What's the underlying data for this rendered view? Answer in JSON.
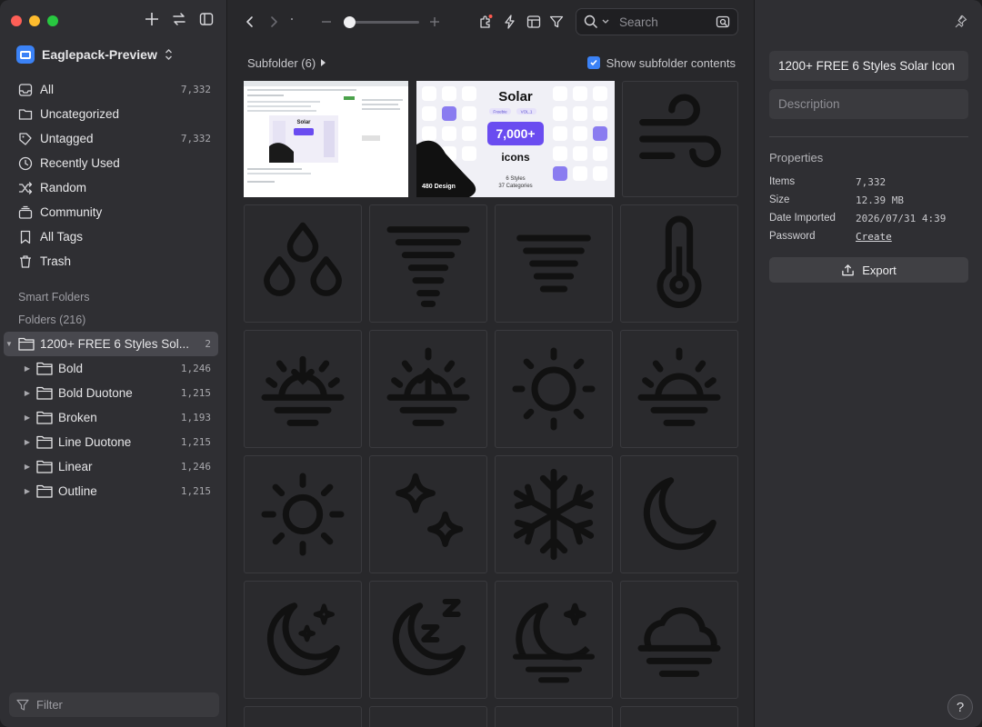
{
  "library": {
    "name": "Eaglepack-Preview"
  },
  "nav": [
    {
      "label": "All",
      "count": "7,332",
      "icon": "inbox-icon"
    },
    {
      "label": "Uncategorized",
      "count": "",
      "icon": "folder-question-icon"
    },
    {
      "label": "Untagged",
      "count": "7,332",
      "icon": "tag-off-icon"
    },
    {
      "label": "Recently Used",
      "count": "",
      "icon": "clock-icon"
    },
    {
      "label": "Random",
      "count": "",
      "icon": "shuffle-icon"
    },
    {
      "label": "Community",
      "count": "",
      "icon": "community-icon"
    },
    {
      "label": "All Tags",
      "count": "",
      "icon": "bookmark-icon"
    },
    {
      "label": "Trash",
      "count": "",
      "icon": "trash-icon"
    }
  ],
  "sections": {
    "smart_folders": "Smart Folders",
    "folders": "Folders (216)"
  },
  "folders": {
    "parent": {
      "label": "1200+ FREE 6 Styles Sol...",
      "count": "2"
    },
    "children": [
      {
        "label": "Bold",
        "count": "1,246"
      },
      {
        "label": "Bold Duotone",
        "count": "1,215"
      },
      {
        "label": "Broken",
        "count": "1,193"
      },
      {
        "label": "Line Duotone",
        "count": "1,215"
      },
      {
        "label": "Linear",
        "count": "1,246"
      },
      {
        "label": "Outline",
        "count": "1,215"
      }
    ]
  },
  "filter": {
    "placeholder": "Filter"
  },
  "toolbar": {
    "search_placeholder": "Search",
    "zoom_level": 0.07
  },
  "subfolder": {
    "title": "Subfolder (6)",
    "show_contents_label": "Show subfolder contents",
    "show_contents_checked": true
  },
  "previews": {
    "solar": {
      "title": "Solar",
      "count_badge": "7,000+",
      "word": "icons",
      "styles": "6 Styles",
      "categories": "37 Categories",
      "brand": "480 Design",
      "tag_a": "Freebie",
      "tag_b": "VOL.1"
    }
  },
  "icons": [
    "wind-icon",
    "raindrops-icon",
    "tornado-icon",
    "tornado-small-icon",
    "thermometer-icon",
    "sunset-icon",
    "sunrise-icon",
    "sun-icon",
    "sun-fog-icon",
    "sun-rays-icon",
    "stars-icon",
    "snowflake-icon",
    "moon-icon",
    "moon-stars-icon",
    "moon-sleep-icon",
    "moon-fog-icon",
    "cloud-fog-icon"
  ],
  "inspector": {
    "name": "1200+ FREE 6 Styles Solar Icon",
    "description_placeholder": "Description",
    "properties_title": "Properties",
    "properties": [
      {
        "key": "Items",
        "value": "7,332"
      },
      {
        "key": "Size",
        "value": "12.39 MB"
      },
      {
        "key": "Date Imported",
        "value": "2026/07/31 4:39"
      },
      {
        "key": "Password",
        "value": "Create"
      }
    ],
    "export_label": "Export",
    "help_label": "?"
  },
  "colors": {
    "accent": "#3b82f6",
    "bg": "#28282b",
    "sidebar": "#2f2f33"
  }
}
